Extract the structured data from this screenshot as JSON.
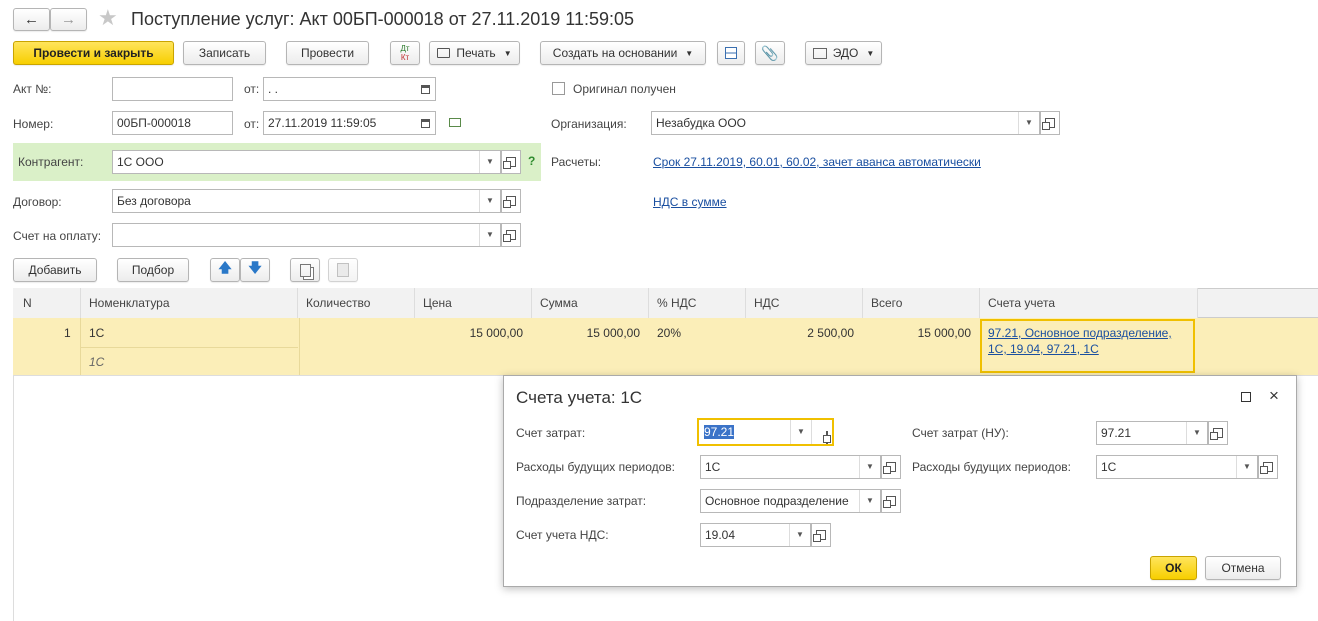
{
  "window": {
    "title": "Поступление услуг: Акт 00БП-000018 от 27.11.2019 11:59:05",
    "back_icon": "arrow-left-icon",
    "forward_icon": "arrow-right-icon",
    "favorite_icon": "star-icon"
  },
  "toolbar": {
    "post_close": "Провести и закрыть",
    "save": "Записать",
    "post": "Провести",
    "dt_kt_top": "Дт",
    "dt_kt_bottom": "Кт",
    "print": "Печать",
    "create_based": "Создать на основании",
    "edo": "ЭДО"
  },
  "form": {
    "act_no_label": "Акт №:",
    "act_no_value": "",
    "from_label": "от:",
    "act_date_value": " .  .",
    "original_label": "Оригинал получен",
    "original_checked": false,
    "number_label": "Номер:",
    "number_value": "00БП-000018",
    "date_value": "27.11.2019 11:59:05",
    "org_label": "Организация:",
    "org_value": "Незабудка ООО",
    "contractor_label": "Контрагент:",
    "contractor_value": "1С ООО",
    "help_mark": "?",
    "settlements_label": "Расчеты:",
    "settlements_link": "Срок 27.11.2019, 60.01, 60.02, зачет аванса автоматически",
    "vat_link": "НДС в сумме",
    "contract_label": "Договор:",
    "contract_value": "Без договора",
    "invoice_label": "Счет на оплату:",
    "invoice_value": ""
  },
  "table_toolbar": {
    "add": "Добавить",
    "pick": "Подбор"
  },
  "table": {
    "headers": [
      "N",
      "Номенклатура",
      "Количество",
      "Цена",
      "Сумма",
      "% НДС",
      "НДС",
      "Всего",
      "Счета учета"
    ],
    "rows": [
      {
        "n": "1",
        "item": "1С",
        "item_sub": "1С",
        "qty": "",
        "price": "15 000,00",
        "sum": "15 000,00",
        "vat_rate": "20%",
        "vat": "2 500,00",
        "total": "15 000,00",
        "accounts_line1": "97.21, Основное подразделение,",
        "accounts_line2": "1С, 19.04, 97.21, 1С"
      }
    ]
  },
  "dialog": {
    "title": "Счета учета: 1С",
    "cost_account_label": "Счет затрат:",
    "cost_account_value": "97.21",
    "cost_account_tax_label": "Счет затрат (НУ):",
    "cost_account_tax_value": "97.21",
    "deferred_label": "Расходы будущих периодов:",
    "deferred_value": "1С",
    "deferred_tax_label": "Расходы будущих периодов:",
    "deferred_tax_value": "1С",
    "division_label": "Подразделение затрат:",
    "division_value": "Основное подразделение",
    "vat_account_label": "Счет учета НДС:",
    "vat_account_value": "19.04",
    "ok": "ОК",
    "cancel": "Отмена"
  },
  "colors": {
    "accent_yellow": "#f7cf00",
    "row_highlight": "#fbeeb8",
    "contractor_bg": "#daf0c8",
    "link": "#1a4fa0"
  }
}
